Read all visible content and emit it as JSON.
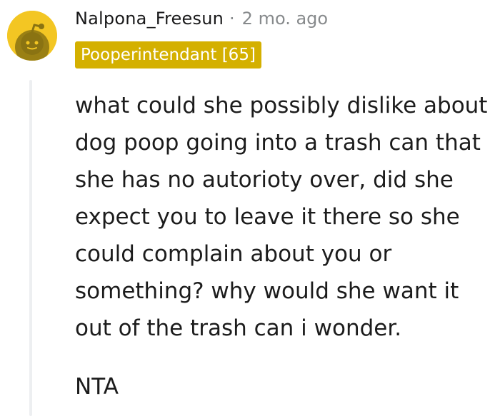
{
  "comment": {
    "author": "Nalpona_Freesun",
    "separator": "·",
    "time_ago": "2 mo. ago",
    "flair": "Pooperintendant [65]",
    "body_text": "what could she possibly dislike about dog poop going into a trash can that she has no autorioty over, did she expect you to leave it there so she could complain about you or something? why would she want it out of the trash can i wonder.",
    "verdict": "NTA"
  },
  "colors": {
    "avatar": "#f3c623",
    "flair_bg": "#d4b000",
    "muted": "#878a8c",
    "text": "#1c1c1c",
    "thread_line": "#edeff1"
  },
  "icons": {
    "avatar": "reddit-snoo-icon"
  }
}
